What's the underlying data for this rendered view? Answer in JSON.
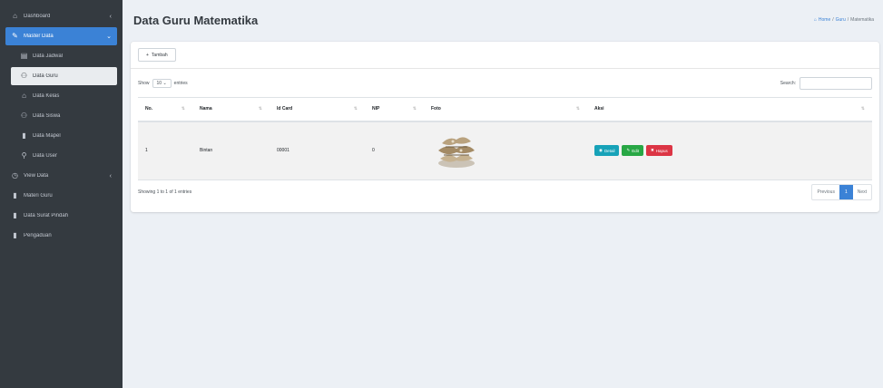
{
  "sidebar": {
    "items": [
      {
        "label": "Dashboard",
        "icon": "home-icon",
        "glyph": "⌂",
        "type": "top",
        "chevron": "‹"
      },
      {
        "label": "Master Data",
        "icon": "edit-icon",
        "glyph": "✎",
        "type": "active-parent",
        "chevron": "⌄"
      },
      {
        "label": "Data Jadwal",
        "icon": "table-icon",
        "glyph": "▤",
        "type": "sub"
      },
      {
        "label": "Data Guru",
        "icon": "users-icon",
        "glyph": "⚇",
        "type": "active-child"
      },
      {
        "label": "Data Kelas",
        "icon": "home-icon",
        "glyph": "⌂",
        "type": "sub"
      },
      {
        "label": "Data Siswa",
        "icon": "users-icon",
        "glyph": "⚇",
        "type": "sub"
      },
      {
        "label": "Data Mapel",
        "icon": "book-icon",
        "glyph": "▮",
        "type": "sub"
      },
      {
        "label": "Data User",
        "icon": "user-plus-icon",
        "glyph": "⚲",
        "type": "sub"
      },
      {
        "label": "View Data",
        "icon": "clock-icon",
        "glyph": "◷",
        "type": "top",
        "chevron": "‹"
      },
      {
        "label": "Materi Guru",
        "icon": "book-icon",
        "glyph": "▮",
        "type": "top"
      },
      {
        "label": "Data Surat Pindah",
        "icon": "file-icon",
        "glyph": "▮",
        "type": "top"
      },
      {
        "label": "Pengaduan",
        "icon": "file-icon",
        "glyph": "▮",
        "type": "top"
      }
    ]
  },
  "header": {
    "title": "Data Guru Matematika",
    "breadcrumb": [
      "Home",
      "Guru",
      "Matematika"
    ]
  },
  "card": {
    "add_label": "Tambah"
  },
  "datatable": {
    "show_label": "Show",
    "entries_value": "10",
    "entries_label": "entries",
    "search_label": "Search:",
    "columns": [
      "No.",
      "Nama",
      "Id Card",
      "NIP",
      "Foto",
      "Aksi"
    ],
    "rows": [
      {
        "no": "1",
        "nama": "Bintan",
        "id_card": "00001",
        "nip": "0"
      }
    ],
    "actions": {
      "detail": "Detail",
      "edit": "Edit",
      "hapus": "Hapus"
    },
    "info": "Showing 1 to 1 of 1 entries",
    "pagination": {
      "previous": "Previous",
      "current": "1",
      "next": "Next"
    }
  },
  "colors": {
    "sidebar_bg": "#343a40",
    "accent": "#3b82d6",
    "detail": "#17a2b8",
    "edit": "#28a745",
    "hapus": "#dc3545"
  }
}
